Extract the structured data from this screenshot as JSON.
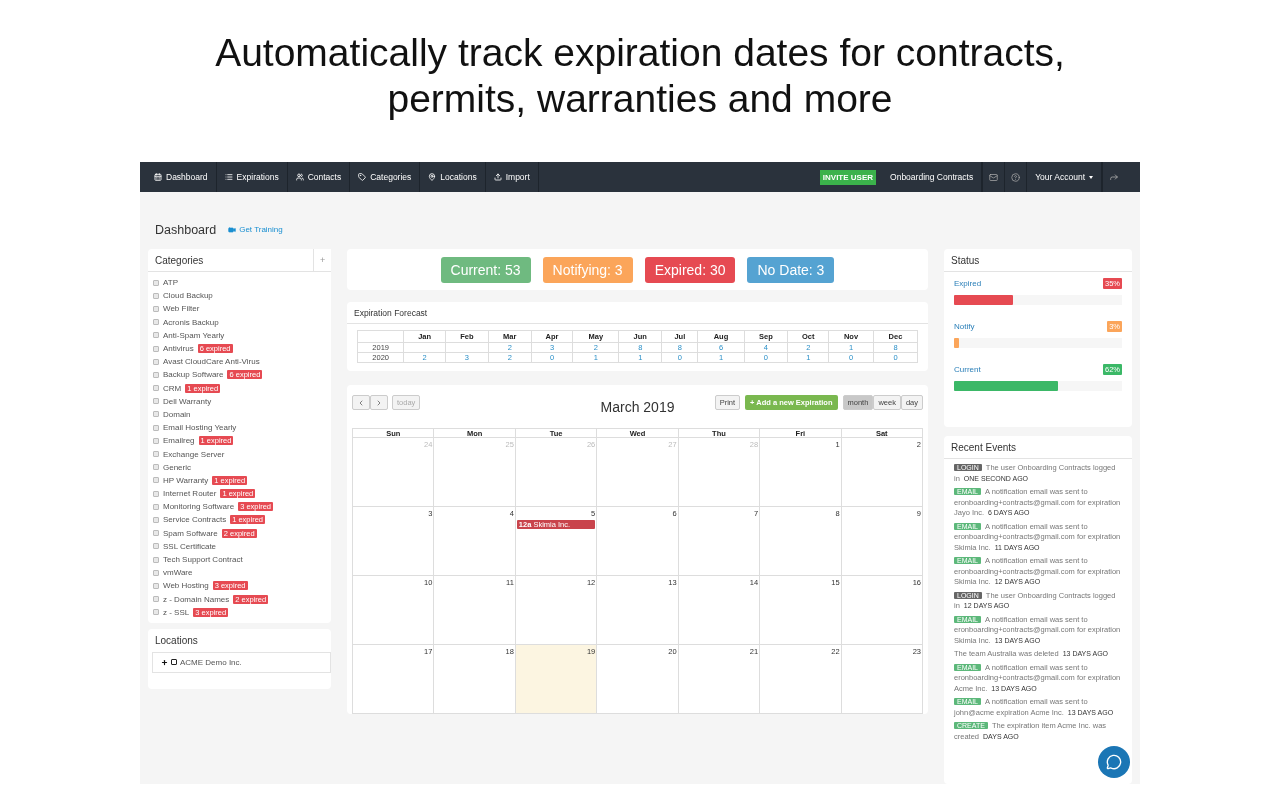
{
  "headline": "Automatically track expiration dates for contracts, permits, warranties and more",
  "navbar": {
    "items": [
      {
        "kind": "dashboard",
        "label": "Dashboard"
      },
      {
        "kind": "list",
        "label": "Expirations"
      },
      {
        "kind": "users",
        "label": "Contacts"
      },
      {
        "kind": "tag",
        "label": "Categories"
      },
      {
        "kind": "pin",
        "label": "Locations"
      },
      {
        "kind": "upload",
        "label": "Import"
      }
    ],
    "invite_button": "INVITE USER",
    "organization": "Onboarding Contracts",
    "account": "Your Account"
  },
  "page_title": "Dashboard",
  "training_link": "Get Training",
  "categories": {
    "title": "Categories",
    "add": "+",
    "items": [
      {
        "name": "ATP",
        "checked": false
      },
      {
        "name": "Cloud Backup",
        "checked": false
      },
      {
        "name": "Web Filter",
        "checked": false
      },
      {
        "name": "Acronis Backup",
        "checked": false
      },
      {
        "name": "Anti-Spam Yearly",
        "checked": false
      },
      {
        "name": "Antivirus",
        "checked": false,
        "badge": "6 expired"
      },
      {
        "name": "Avast CloudCare Anti-Virus",
        "checked": false
      },
      {
        "name": "Backup Software",
        "checked": false,
        "badge": "6 expired"
      },
      {
        "name": "CRM",
        "checked": false,
        "badge": "1 expired"
      },
      {
        "name": "Dell Warranty",
        "checked": false
      },
      {
        "name": "Domain",
        "checked": false
      },
      {
        "name": "Email Hosting Yearly",
        "checked": false
      },
      {
        "name": "Emailreg",
        "checked": false,
        "badge": "1 expired"
      },
      {
        "name": "Exchange Server",
        "checked": false
      },
      {
        "name": "Generic",
        "checked": false
      },
      {
        "name": "HP Warranty",
        "checked": false,
        "badge": "1 expired"
      },
      {
        "name": "Internet Router",
        "checked": false,
        "badge": "1 expired"
      },
      {
        "name": "Monitoring Software",
        "checked": false,
        "badge": "3 expired"
      },
      {
        "name": "Service Contracts",
        "checked": false,
        "badge": "1 expired"
      },
      {
        "name": "Spam Software",
        "checked": false,
        "badge": "2 expired"
      },
      {
        "name": "SSL Certificate",
        "checked": false
      },
      {
        "name": "Tech Support Contract",
        "checked": false
      },
      {
        "name": "vmWare",
        "checked": false
      },
      {
        "name": "Web Hosting",
        "checked": false,
        "badge": "3 expired"
      },
      {
        "name": "z - Domain Names",
        "checked": false,
        "badge": "2 expired"
      },
      {
        "name": "z - SSL",
        "checked": false,
        "badge": "3 expired"
      }
    ]
  },
  "locations": {
    "title": "Locations",
    "items": [
      {
        "name": "ACME Demo Inc.",
        "checked": false
      }
    ]
  },
  "counts": [
    {
      "label": "Current: 53",
      "color": "#6fba80"
    },
    {
      "label": "Notifying: 3",
      "color": "#fba55a"
    },
    {
      "label": "Expired: 30",
      "color": "#e64a52"
    },
    {
      "label": "No Date: 3",
      "color": "#55a3d2"
    }
  ],
  "forecast": {
    "title": "Expiration Forecast",
    "columns": [
      "Jan",
      "Feb",
      "Mar",
      "Apr",
      "May",
      "Jun",
      "Jul",
      "Aug",
      "Sep",
      "Oct",
      "Nov",
      "Dec"
    ],
    "rows": [
      {
        "year": "2019",
        "values": [
          "2",
          "3",
          "2",
          "8",
          "8",
          "6",
          "4",
          "2",
          "1",
          "8"
        ]
      },
      {
        "year": "2020",
        "values": [
          "2",
          "3",
          "2",
          "0",
          "1",
          "1",
          "0",
          "1",
          "0",
          "1",
          "0",
          "0"
        ]
      }
    ]
  },
  "calendar": {
    "title": "March 2019",
    "today_button": "today",
    "print_button": "Print",
    "add_button": "+ Add a new Expiration",
    "views": [
      {
        "label": "month",
        "selected": true
      },
      {
        "label": "week",
        "selected": false
      },
      {
        "label": "day",
        "selected": false
      }
    ],
    "weekdays": [
      "Sun",
      "Mon",
      "Tue",
      "Wed",
      "Thu",
      "Fri",
      "Sat"
    ],
    "weeks": [
      {
        "days": [
          {
            "date": "24",
            "other_month": true
          },
          {
            "date": "25",
            "other_month": true
          },
          {
            "date": "26",
            "other_month": true
          },
          {
            "date": "27",
            "other_month": true
          },
          {
            "date": "28",
            "other_month": true
          },
          {
            "date": "1",
            "other_month": false
          },
          {
            "date": "2",
            "other_month": false
          }
        ]
      },
      {
        "days": [
          {
            "date": "3",
            "other_month": false
          },
          {
            "date": "4",
            "other_month": false
          },
          {
            "date": "5",
            "other_month": false,
            "events": [
              {
                "time": "12a",
                "title": "Skimia Inc."
              }
            ]
          },
          {
            "date": "6",
            "other_month": false
          },
          {
            "date": "7",
            "other_month": false
          },
          {
            "date": "8",
            "other_month": false
          },
          {
            "date": "9",
            "other_month": false
          }
        ]
      },
      {
        "days": [
          {
            "date": "10",
            "other_month": false
          },
          {
            "date": "11",
            "other_month": false
          },
          {
            "date": "12",
            "other_month": false
          },
          {
            "date": "13",
            "other_month": false
          },
          {
            "date": "14",
            "other_month": false
          },
          {
            "date": "15",
            "other_month": false
          },
          {
            "date": "16",
            "other_month": false
          }
        ]
      },
      {
        "days": [
          {
            "date": "17",
            "other_month": false
          },
          {
            "date": "18",
            "other_month": false
          },
          {
            "date": "19",
            "other_month": false,
            "today": true
          },
          {
            "date": "20",
            "other_month": false
          },
          {
            "date": "21",
            "other_month": false
          },
          {
            "date": "22",
            "other_month": false
          },
          {
            "date": "23",
            "other_month": false
          }
        ]
      }
    ]
  },
  "status": {
    "title": "Status",
    "items": [
      {
        "label": "Expired",
        "percent": "35%",
        "color": "#e64a52",
        "level": 0.35
      },
      {
        "label": "Notify",
        "percent": "3%",
        "color": "#fba55a",
        "level": 0.03
      },
      {
        "label": "Current",
        "percent": "62%",
        "color": "#3bb867",
        "level": 0.62
      }
    ]
  },
  "recent_events": {
    "title": "Recent Events",
    "items": [
      {
        "tag": "LOGIN",
        "color": "#666666",
        "text": "The user Onboarding Contracts logged in",
        "time": "ONE SECOND AGO"
      },
      {
        "tag": "EMAIL",
        "color": "#5cb87a",
        "text": "A notification email was sent to eronboarding+contracts@gmail.com for expiration Jayo Inc.",
        "time": "6 DAYS AGO"
      },
      {
        "tag": "EMAIL",
        "color": "#5cb87a",
        "text": "A notification email was sent to eronboarding+contracts@gmail.com for expiration Skimia Inc.",
        "time": "11 DAYS AGO"
      },
      {
        "tag": "EMAIL",
        "color": "#5cb87a",
        "text": "A notification email was sent to eronboarding+contracts@gmail.com for expiration Skimia Inc.",
        "time": "12 DAYS AGO"
      },
      {
        "tag": "LOGIN",
        "color": "#666666",
        "text": "The user Onboarding Contracts logged in",
        "time": "12 DAYS AGO"
      },
      {
        "tag": "EMAIL",
        "color": "#5cb87a",
        "text": "A notification email was sent to eronboarding+contracts@gmail.com for expiration Skimia Inc.",
        "time": "13 DAYS AGO"
      },
      {
        "text": "The team Australia was deleted",
        "time": "13 DAYS AGO"
      },
      {
        "tag": "EMAIL",
        "color": "#5cb87a",
        "text": "A notification email was sent to eronboarding+contracts@gmail.com for expiration Acme Inc.",
        "time": "13 DAYS AGO"
      },
      {
        "tag": "EMAIL",
        "color": "#5cb87a",
        "text": "A notification email was sent to john@acme expiration Acme Inc.",
        "time": "13 DAYS AGO"
      },
      {
        "tag": "CREATE",
        "color": "#5cb87a",
        "text": "The expiration item Acme Inc. was created",
        "time": "DAYS AGO"
      }
    ]
  }
}
